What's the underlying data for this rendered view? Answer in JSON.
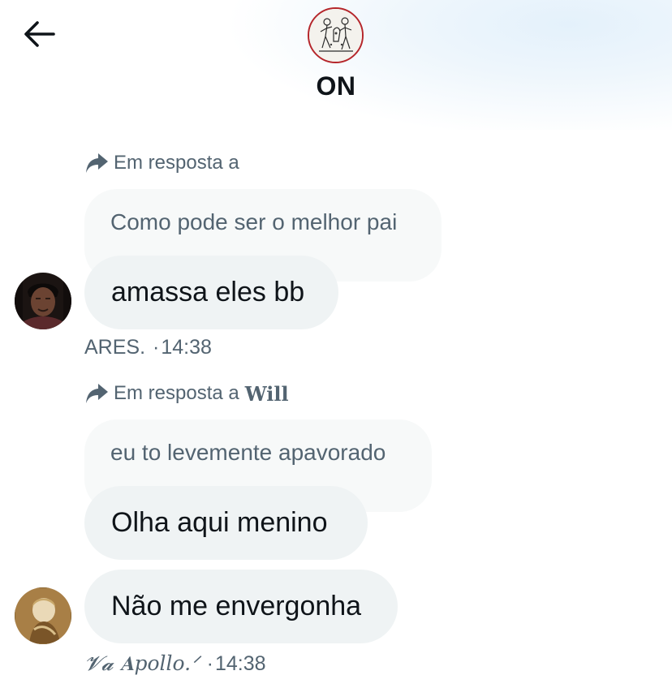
{
  "header": {
    "title": "ON",
    "avatar_icon": "group-avatar-art"
  },
  "messages": [
    {
      "reply_label": "Em resposta a",
      "reply_to": "",
      "quoted_text": "Como pode ser o melhor pai",
      "bubbles": [
        "amassa eles bb"
      ],
      "sender": "ARES.",
      "time": "14:38"
    },
    {
      "reply_label": "Em resposta a",
      "reply_to": "Will",
      "quoted_text": "eu to levemente apavorado",
      "bubbles": [
        "Olha aqui menino",
        "Não me envergonha"
      ],
      "sender": "𝓥𝓪 𝐀pollo.ᐟ",
      "time": "14:38"
    }
  ],
  "separator": "·",
  "colors": {
    "bubble_bg": "#eff3f4",
    "quoted_bg": "#f7f9f9",
    "secondary_text": "#536471",
    "primary_text": "#0f1419",
    "avatar_ring": "#b5262b"
  }
}
